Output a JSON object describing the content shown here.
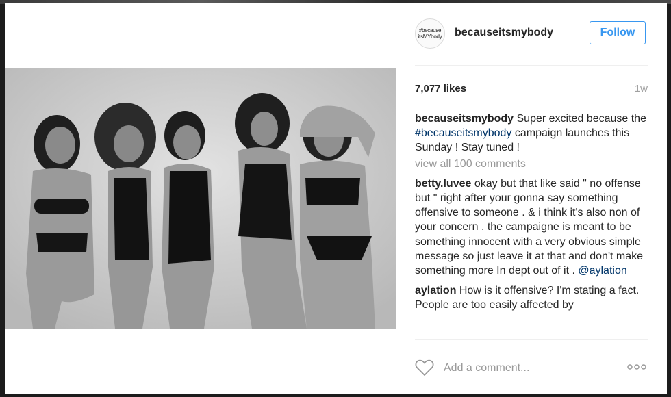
{
  "post": {
    "avatar_text": [
      "#because",
      "itsMYbody"
    ],
    "username": "becauseitsmybody",
    "follow_label": "Follow",
    "likes": "7,077 likes",
    "time": "1w",
    "caption": {
      "user": "becauseitsmybody",
      "text_before": " Super excited because the ",
      "hashtag": "#becauseitsmybody",
      "text_after": " campaign launches this Sunday ! Stay tuned !"
    },
    "view_all": "view all 100 comments",
    "comments": [
      {
        "user": "betty.luvee",
        "text": " okay but that like said \" no offense but \" right after your gonna say something offensive to someone . & i think it's also non of your concern , the campaigne is meant to be something innocent with a very obvious simple message so just leave it at that and don't make something more In dept out of it . ",
        "mention": "@aylation"
      },
      {
        "user": "aylation",
        "text": " How is it offensive? I'm stating a fact. People are too easily affected by"
      }
    ],
    "comment_placeholder": "Add a comment..."
  },
  "colors": {
    "accent": "#3897f0",
    "link": "#003569",
    "muted": "#999999"
  },
  "icons": [
    "heart-icon",
    "more-options-icon"
  ]
}
